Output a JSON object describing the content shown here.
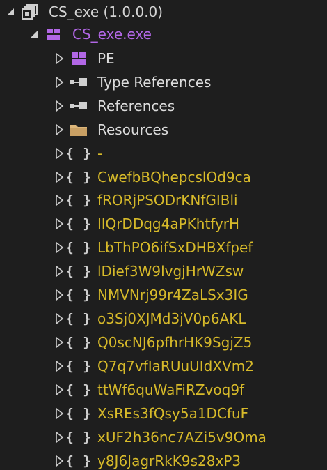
{
  "colors": {
    "background": "#1e1e1e",
    "assembly_text": "#d4d4d4",
    "module_text": "#b267e6",
    "node_text": "#dcdcdc",
    "namespace_text": "#d7ba2a"
  },
  "tree": {
    "assembly": {
      "label": "CS_exe (1.0.0.0)",
      "icon": "assembly-icon",
      "expanded": true
    },
    "module": {
      "label": "CS_exe.exe",
      "icon": "module-icon",
      "expanded": true
    },
    "nodes": [
      {
        "label": "PE",
        "icon": "pe-icon"
      },
      {
        "label": "Type References",
        "icon": "type-references-icon"
      },
      {
        "label": "References",
        "icon": "references-icon"
      },
      {
        "label": "Resources",
        "icon": "folder-icon"
      }
    ],
    "namespaces": [
      "-",
      "CwefbBQhepcslOd9ca",
      "fRORjPSODrKNfGIBli",
      "IlQrDDqg4aPKhtfyrH",
      "LbThPO6ifSxDHBXfpef",
      "lDief3W9lvgjHrWZsw",
      "NMVNrj99r4ZaLSx3IG",
      "o3Sj0XJMd3jV0p6AKL",
      "Q0scNJ6pfhrHK9SgjZ5",
      "Q7q7vfIaRUuUIdXVm2",
      "ttWf6quWaFiRZvoq9f",
      "XsREs3fQsy5a1DCfuF",
      "xUF2h36nc7AZi5v9Oma",
      "y8J6JagrRkK9s28xP3"
    ]
  }
}
